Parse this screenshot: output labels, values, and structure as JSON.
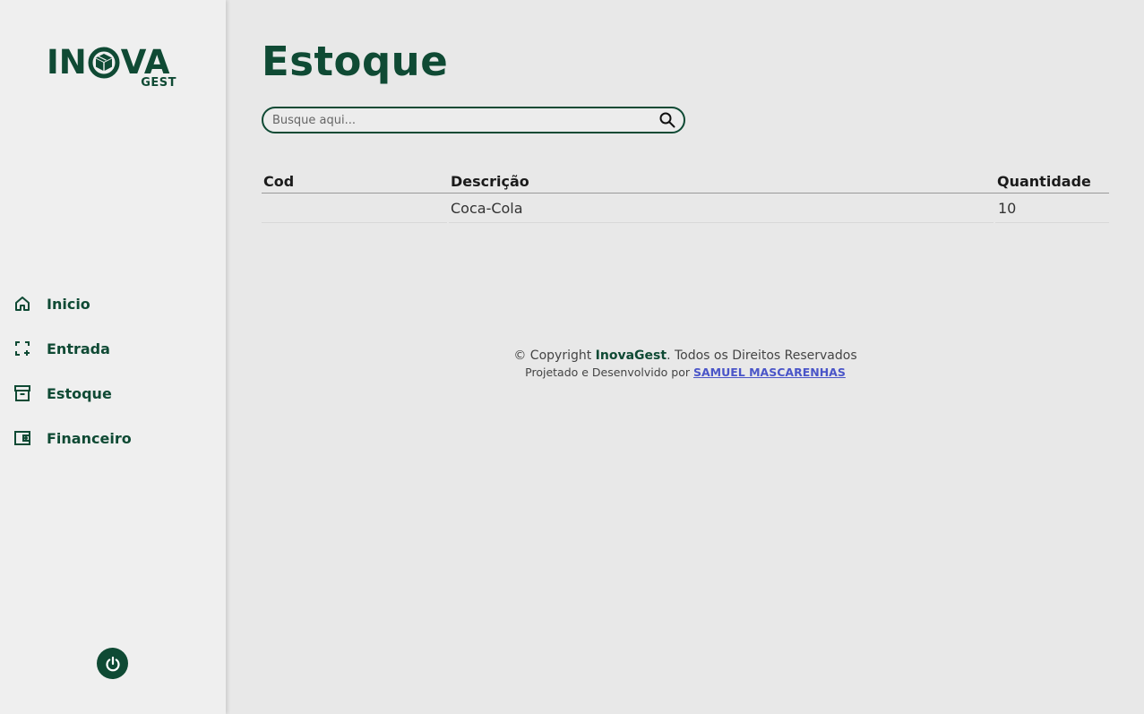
{
  "logo": {
    "main_left": "IN",
    "main_right": "VA",
    "sub": "GEST"
  },
  "sidebar": {
    "items": [
      {
        "label": "Inicio",
        "icon": "home-icon"
      },
      {
        "label": "Entrada",
        "icon": "entry-icon"
      },
      {
        "label": "Estoque",
        "icon": "archive-icon"
      },
      {
        "label": "Financeiro",
        "icon": "wallet-icon"
      }
    ],
    "power_icon": "power-icon"
  },
  "main": {
    "title": "Estoque",
    "search": {
      "placeholder": "Busque aqui...",
      "value": ""
    },
    "table": {
      "columns": [
        "Cod",
        "Descrição",
        "Quantidade"
      ],
      "rows": [
        {
          "cod": "",
          "descricao": "Coca-Cola",
          "quantidade": "10"
        }
      ]
    },
    "footer": {
      "copyright_prefix": "© Copyright ",
      "brand": "InovaGest",
      "copyright_suffix": ". Todos os Direitos Reservados",
      "credit_prefix": "Projetado e Desenvolvido por ",
      "author": "SAMUEL MASCARENHAS"
    }
  },
  "colors": {
    "brand": "#0f4a34",
    "background": "#e8e8e8",
    "sidebar": "#efefef",
    "link": "#4a55c8"
  }
}
